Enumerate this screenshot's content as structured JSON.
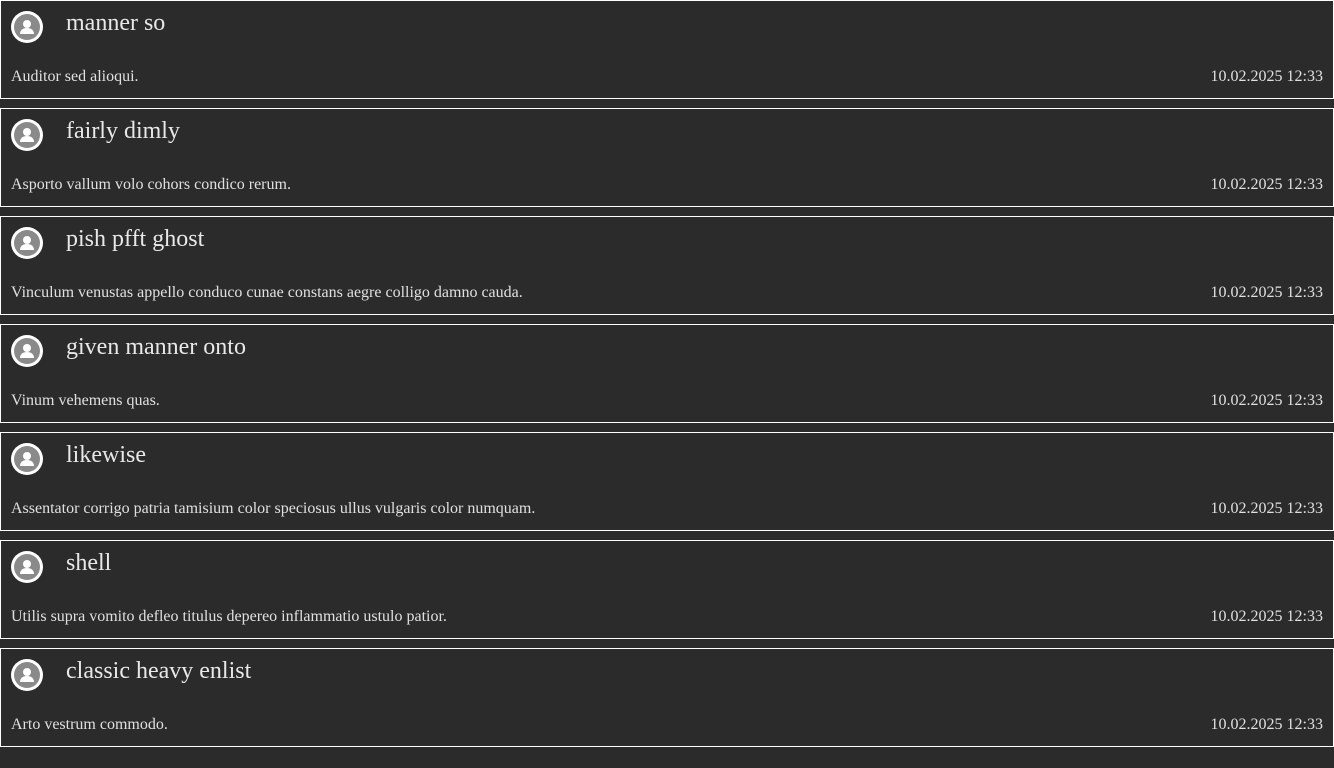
{
  "notifications": [
    {
      "title": "manner so",
      "message": "Auditor sed alioqui.",
      "timestamp": "10.02.2025 12:33",
      "icon": "user-avatar-icon"
    },
    {
      "title": "fairly dimly",
      "message": "Asporto vallum volo cohors condico rerum.",
      "timestamp": "10.02.2025 12:33",
      "icon": "user-avatar-icon"
    },
    {
      "title": "pish pfft ghost",
      "message": "Vinculum venustas appello conduco cunae constans aegre colligo damno cauda.",
      "timestamp": "10.02.2025 12:33",
      "icon": "user-avatar-icon"
    },
    {
      "title": "given manner onto",
      "message": "Vinum vehemens quas.",
      "timestamp": "10.02.2025 12:33",
      "icon": "user-avatar-icon"
    },
    {
      "title": "likewise",
      "message": "Assentator corrigo patria tamisium color speciosus ullus vulgaris color numquam.",
      "timestamp": "10.02.2025 12:33",
      "icon": "user-avatar-icon"
    },
    {
      "title": "shell",
      "message": "Utilis supra vomito defleo titulus depereo inflammatio ustulo patior.",
      "timestamp": "10.02.2025 12:33",
      "icon": "user-avatar-icon"
    },
    {
      "title": "classic heavy enlist",
      "message": "Arto vestrum commodo.",
      "timestamp": "10.02.2025 12:33",
      "icon": "user-avatar-icon"
    }
  ],
  "colors": {
    "background": "#2b2b2b",
    "border": "#ffffff",
    "avatar_bg": "#ffffff",
    "avatar_fg": "#8a8a8a"
  }
}
